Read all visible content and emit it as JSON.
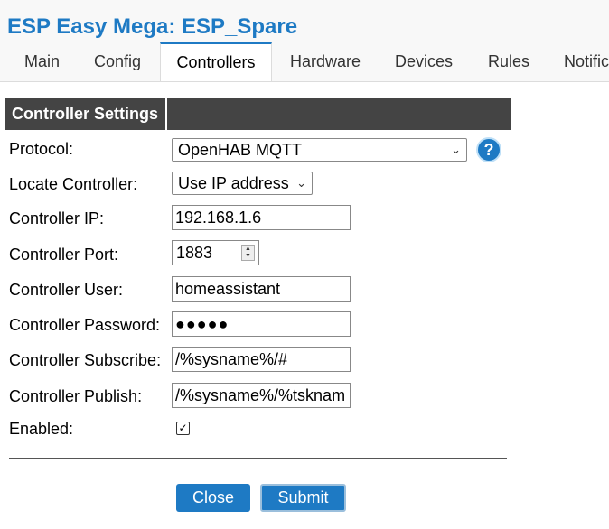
{
  "app": {
    "title": "ESP Easy Mega: ESP_Spare"
  },
  "tabs": [
    {
      "label": "Main"
    },
    {
      "label": "Config"
    },
    {
      "label": "Controllers"
    },
    {
      "label": "Hardware"
    },
    {
      "label": "Devices"
    },
    {
      "label": "Rules"
    },
    {
      "label": "Notific"
    }
  ],
  "active_tab": "Controllers",
  "settings": {
    "header": "Controller Settings",
    "protocol": {
      "label": "Protocol:",
      "value": "OpenHAB MQTT",
      "help_icon": "question-mark"
    },
    "locate": {
      "label": "Locate Controller:",
      "value": "Use IP address"
    },
    "ip": {
      "label": "Controller IP:",
      "value": "192.168.1.6"
    },
    "port": {
      "label": "Controller Port:",
      "value": "1883"
    },
    "user": {
      "label": "Controller User:",
      "value": "homeassistant"
    },
    "password": {
      "label": "Controller Password:",
      "value": "●●●●●"
    },
    "subscribe": {
      "label": "Controller Subscribe:",
      "value": "/%sysname%/#"
    },
    "publish": {
      "label": "Controller Publish:",
      "value": "/%sysname%/%tsknam"
    },
    "enabled": {
      "label": "Enabled:",
      "checked": true,
      "mark": "✓"
    }
  },
  "buttons": {
    "close": "Close",
    "submit": "Submit"
  },
  "colors": {
    "accent": "#1e7ac4",
    "header_bg": "#444444"
  }
}
